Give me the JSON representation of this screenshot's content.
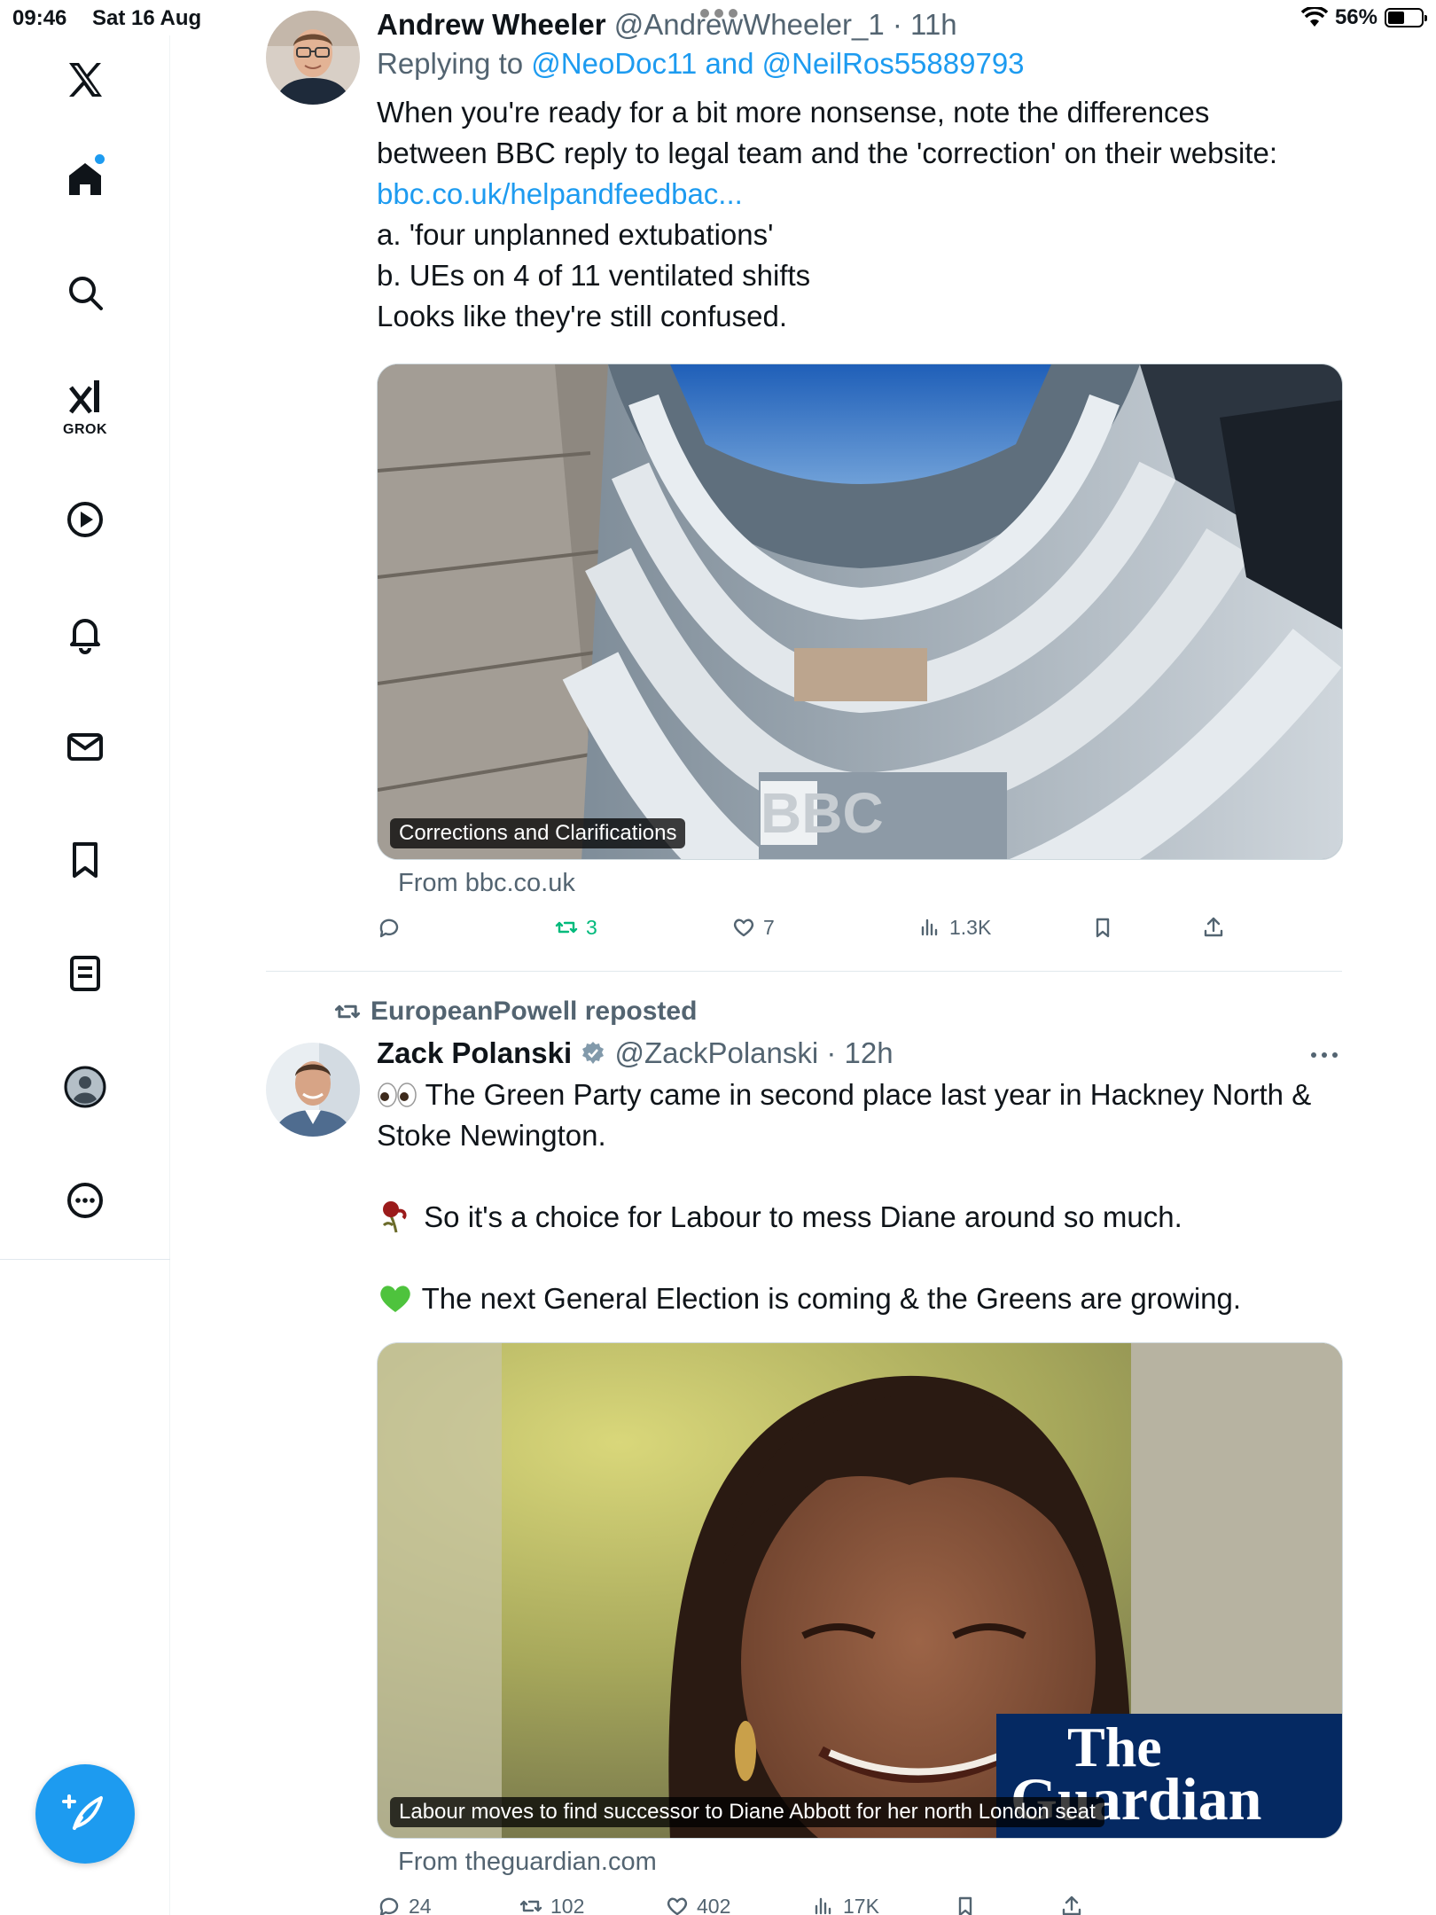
{
  "status_bar": {
    "time": "09:46",
    "date": "Sat 16 Aug",
    "battery": "56%",
    "battery_level": 0.56
  },
  "sidebar": {
    "items": [
      {
        "icon": "x-logo-icon"
      },
      {
        "icon": "home-icon"
      },
      {
        "icon": "search-icon"
      },
      {
        "icon": "grok-icon",
        "label": "GROK"
      },
      {
        "icon": "video-icon"
      },
      {
        "icon": "notifications-icon"
      },
      {
        "icon": "messages-icon"
      },
      {
        "icon": "bookmarks-icon"
      },
      {
        "icon": "lists-icon"
      },
      {
        "icon": "profile-icon"
      },
      {
        "icon": "more-icon"
      }
    ],
    "compose_icon": "compose-post-icon"
  },
  "tweets": [
    {
      "author": "Andrew Wheeler",
      "handle": "@AndrewWheeler_1",
      "time": "· 11h",
      "reply_prefix": "Replying to",
      "reply_mention_1": "@NeoDoc11",
      "reply_and": "and",
      "reply_mention_2": "@NeilRos55889793",
      "text_line_1": "When you're ready for a bit more nonsense, note the differences",
      "text_line_2": "between BBC reply to legal team and the 'correction' on their website:",
      "link": "bbc.co.uk/helpandfeedbac...",
      "text_line_4": "a. 'four unplanned extubations'",
      "text_line_5": "b. UEs on 4 of 11 ventilated shifts",
      "text_line_6": "Looks like they're still confused.",
      "card_caption": "Corrections and Clarifications",
      "card_image_text": "BBC",
      "card_source": "From bbc.co.uk",
      "actions": {
        "replies": "",
        "reposts": "3",
        "likes": "7",
        "views": "1.3K"
      }
    },
    {
      "reposted_by": "EuropeanPowell reposted",
      "author": "Zack Polanski",
      "handle": "@ZackPolanski",
      "time": "· 12h",
      "text_line_1": "The Green Party came in second place last year in Hackney North &",
      "text_line_2": "Stoke Newington.",
      "text_line_3": "So it's a choice for Labour to mess Diane around so much.",
      "text_line_4": "The next General Election is coming & the Greens are growing.",
      "card_caption": "Labour moves to find successor to Diane Abbott for her north London seat",
      "card_brand_1": "The",
      "card_brand_2": "Guardian",
      "card_source": "From theguardian.com",
      "actions": {
        "replies": "24",
        "reposts": "102",
        "likes": "402",
        "views": "17K"
      }
    }
  ]
}
